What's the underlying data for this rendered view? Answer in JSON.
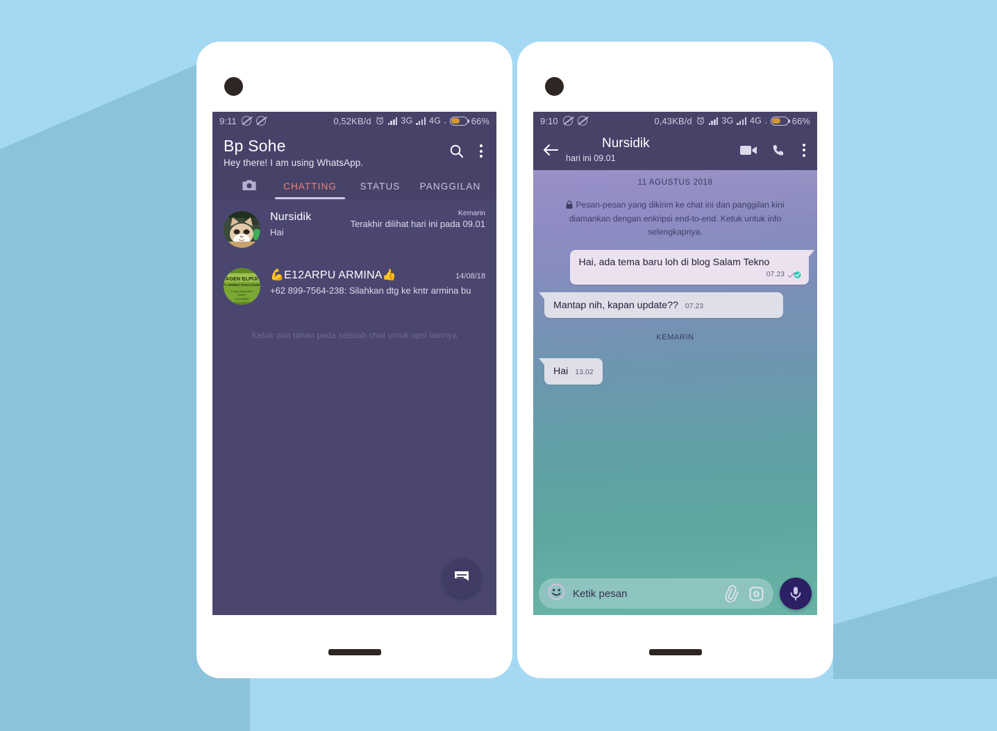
{
  "background": {
    "base_color": "#a5d8f3",
    "shadow_color": "#8cc3dc"
  },
  "phones": {
    "left": {
      "status_bar": {
        "time": "9:11",
        "data_rate": "0,52KB/d",
        "network_1": "3G",
        "network_2": "4G",
        "network_2_sub": "„",
        "battery_percent": "66%",
        "icons": [
          "sync-icon",
          "sync-icon",
          "alarm-icon",
          "signal-bars-icon",
          "signal-bars-icon",
          "battery-icon"
        ]
      },
      "app_bar": {
        "title": "Bp Sohe",
        "status_text": "Hey there! I am using WhatsApp.",
        "search_icon": "search-icon",
        "overflow_icon": "kebab-menu-icon"
      },
      "tabs": {
        "camera_icon": "camera-icon",
        "items": [
          {
            "label": "CHATTING",
            "active": true
          },
          {
            "label": "STATUS",
            "active": false
          },
          {
            "label": "PANGGILAN",
            "active": false
          }
        ],
        "active_color": "#ef8273",
        "indicator_color": "#cdc9e8"
      },
      "chats": [
        {
          "name": "Nursidik",
          "avatar": "cat-photo-avatar",
          "time": "Kemarin",
          "last_seen": "Terakhir dilihat hari ini pada 09.01",
          "preview": "Hai"
        },
        {
          "name": "💪E12ARPU ARMINA👍",
          "avatar": "agen-elpiji-logo-avatar",
          "avatar_text_line1": "AGEN ELPIJI",
          "avatar_text_line2": "PT. ARMINA PANCAGUNA",
          "avatar_text_line3": "Jl. Raya Karang Sem, Cirebon",
          "avatar_text_line4": "0231-636983",
          "time": "14/08/18",
          "preview": "+62 899-7564-238: Silahkan dtg ke kntr armina bu"
        }
      ],
      "hint_text": "Ketuk dan tahan pada sebuah chat untuk opsi lainnya",
      "fab": {
        "icon": "new-chat-message-icon",
        "background": "#403c63"
      }
    },
    "right": {
      "status_bar": {
        "time": "9:10",
        "data_rate": "0,43KB/d",
        "network_1": "3G",
        "network_2": "4G",
        "network_2_sub": "„",
        "battery_percent": "66%"
      },
      "app_bar": {
        "back_icon": "back-arrow-icon",
        "contact_name": "Nursidik",
        "contact_status": "hari ini 09.01",
        "video_call_icon": "video-camera-icon",
        "voice_call_icon": "phone-icon",
        "overflow_icon": "kebab-menu-icon"
      },
      "conversation": {
        "date_divider_1": "11 AGUSTUS 2018",
        "encryption_notice": "Pesan-pesan yang dikirim ke chat ini dan panggilan kini diamankan dengan enkripsi end-to-end. Ketuk untuk info selengkapnya.",
        "lock_icon": "lock-icon",
        "date_divider_2": "KEMARIN",
        "messages": [
          {
            "direction": "out",
            "text": "Hai, ada tema baru loh di blog Salam Tekno",
            "time": "07.23",
            "receipt": "read-double-check-icon",
            "receipt_color": "#2ec5b6"
          },
          {
            "direction": "in",
            "text": "Mantap nih, kapan update??",
            "time": "07.23"
          },
          {
            "direction": "in",
            "text": "Hai",
            "time": "13.02"
          }
        ]
      },
      "input_bar": {
        "emoji_icon": "emoji-smiley-icon",
        "placeholder": "Ketik pesan",
        "attach_icon": "paperclip-icon",
        "camera_icon": "camera-icon",
        "mic_icon": "microphone-icon",
        "mic_background": "#2c1f63",
        "field_background": "#8ec4c0"
      }
    }
  }
}
